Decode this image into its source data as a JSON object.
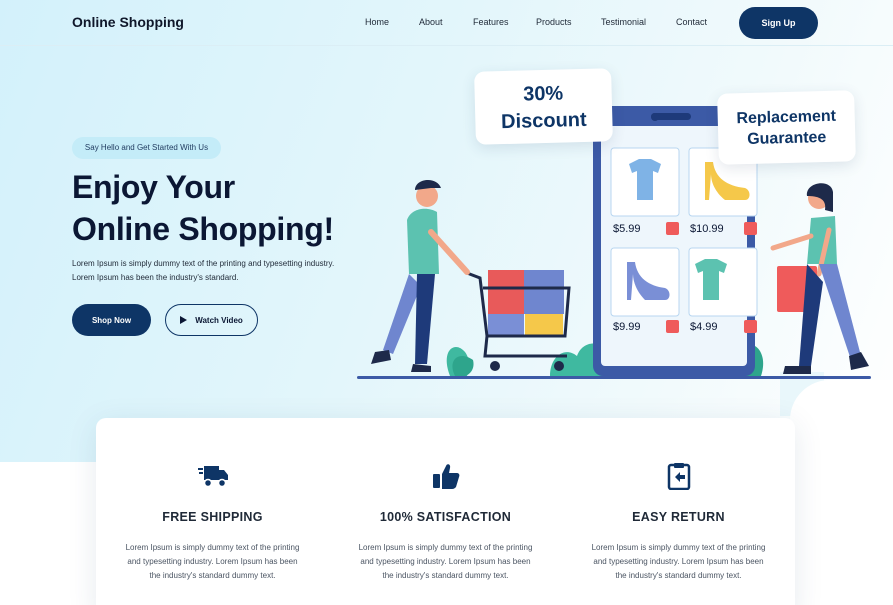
{
  "colors": {
    "primary": "#0e3566",
    "hero_bg": "#d3f1fb",
    "accent_green": "#3fb9a0",
    "accent_red": "#ef5b5b"
  },
  "nav": {
    "logo": "Online Shopping",
    "links": [
      "Home",
      "About",
      "Features",
      "Products",
      "Testimonial",
      "Contact"
    ],
    "signup": "Sign Up"
  },
  "hero": {
    "tag": "Say Hello and Get Started With Us",
    "title_line1": "Enjoy Your",
    "title_line2": "Online Shopping!",
    "desc_line1": "Lorem Ipsum is simply dummy text of the printing and typesetting industry.",
    "desc_line2": "Lorem Ipsum has been the industry's standard.",
    "shop_now": "Shop Now",
    "watch_video": "Watch Video"
  },
  "illustration": {
    "discount_line1": "30%",
    "discount_line2": "Discount",
    "guarantee_line1": "Replacement",
    "guarantee_line2": "Guarantee",
    "prices": [
      "$5.99",
      "$10.99",
      "$9.99",
      "$4.99"
    ],
    "icons": [
      "tshirt-icon",
      "heel-shoe-icon",
      "heel-shoe-icon",
      "tshirt-icon",
      "shopping-cart-icon"
    ]
  },
  "features": [
    {
      "icon": "delivery-truck-icon",
      "title": "FREE SHIPPING",
      "line1": "Lorem Ipsum is simply dummy text of the printing",
      "line2": "and typesetting industry. Lorem Ipsum has been",
      "line3": "the industry's standard dummy text."
    },
    {
      "icon": "thumbs-up-icon",
      "title": "100% SATISFACTION",
      "line1": "Lorem Ipsum is simply dummy text of the printing",
      "line2": "and typesetting industry. Lorem Ipsum has been",
      "line3": "the industry's standard dummy text."
    },
    {
      "icon": "return-clipboard-icon",
      "title": "EASY RETURN",
      "line1": "Lorem Ipsum is simply dummy text of the printing",
      "line2": "and typesetting industry. Lorem Ipsum has been",
      "line3": "the industry's standard dummy text."
    }
  ]
}
